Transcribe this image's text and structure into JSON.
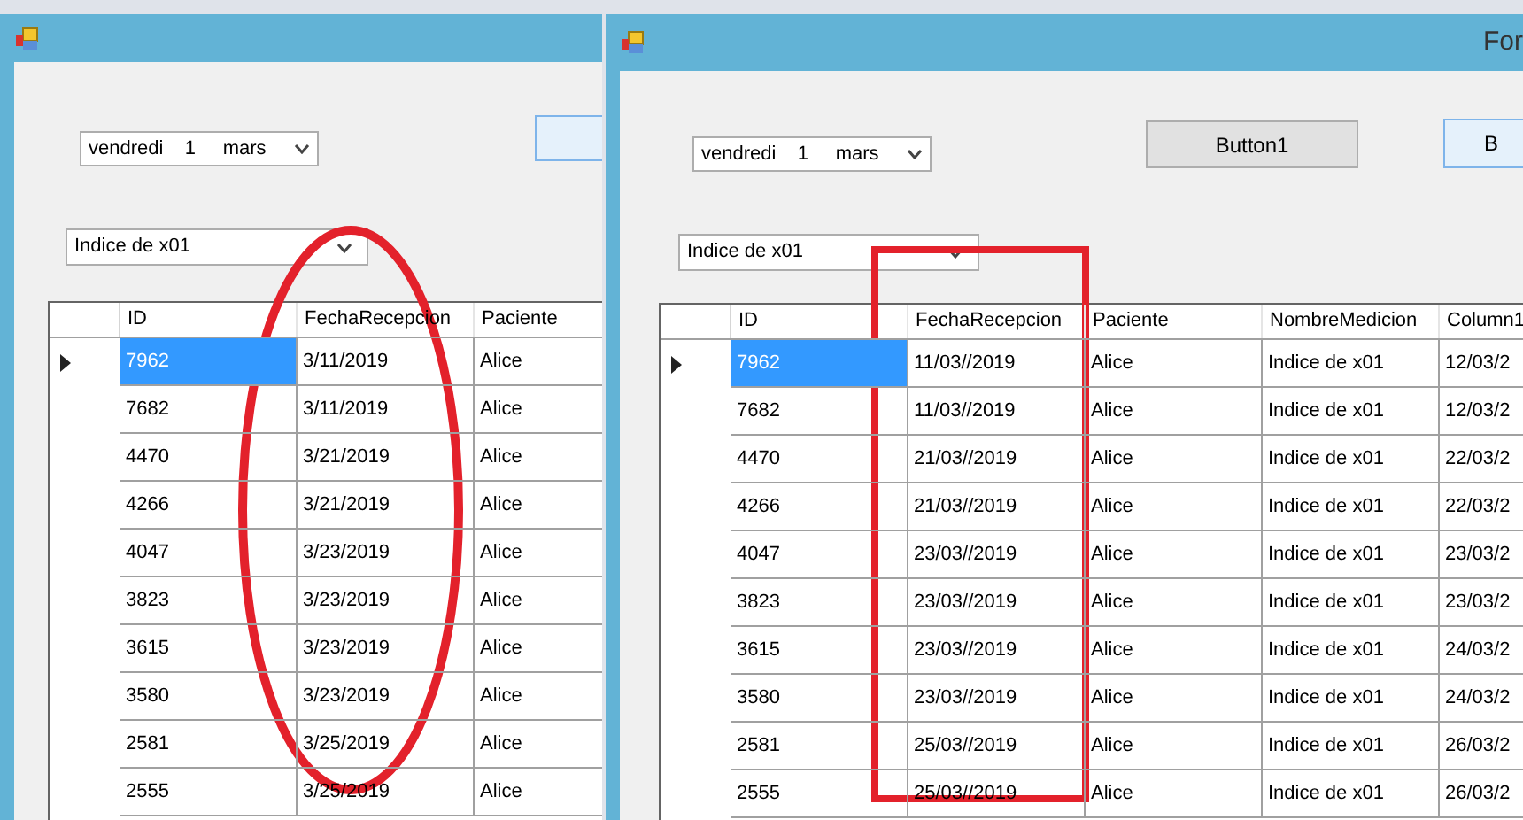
{
  "windows": [
    {
      "date_picker": {
        "value": "vendredi    1     mars"
      },
      "combo": {
        "value": "Indice de x01"
      },
      "grid": {
        "columns": [
          "ID",
          "FechaRecepcion",
          "Paciente"
        ],
        "rows": [
          {
            "selected": true,
            "cells": [
              "7962",
              "3/11/2019",
              "Alice"
            ]
          },
          {
            "selected": false,
            "cells": [
              "7682",
              "3/11/2019",
              "Alice"
            ]
          },
          {
            "selected": false,
            "cells": [
              "4470",
              "3/21/2019",
              "Alice"
            ]
          },
          {
            "selected": false,
            "cells": [
              "4266",
              "3/21/2019",
              "Alice"
            ]
          },
          {
            "selected": false,
            "cells": [
              "4047",
              "3/23/2019",
              "Alice"
            ]
          },
          {
            "selected": false,
            "cells": [
              "3823",
              "3/23/2019",
              "Alice"
            ]
          },
          {
            "selected": false,
            "cells": [
              "3615",
              "3/23/2019",
              "Alice"
            ]
          },
          {
            "selected": false,
            "cells": [
              "3580",
              "3/23/2019",
              "Alice"
            ]
          },
          {
            "selected": false,
            "cells": [
              "2581",
              "3/25/2019",
              "Alice"
            ]
          },
          {
            "selected": false,
            "cells": [
              "2555",
              "3/25/2019",
              "Alice"
            ]
          }
        ]
      },
      "annotation": {
        "kind": "ellipse"
      }
    },
    {
      "title": "For",
      "date_picker": {
        "value": "vendredi    1     mars"
      },
      "buttons": [
        "Button1",
        "B"
      ],
      "combo": {
        "value": "Indice de x01"
      },
      "grid": {
        "columns": [
          "ID",
          "FechaRecepcion",
          "Paciente",
          "NombreMedicion",
          "Column1"
        ],
        "rows": [
          {
            "selected": true,
            "cells": [
              "7962",
              "11/03//2019",
              "Alice",
              "Indice de x01",
              "12/03/2"
            ]
          },
          {
            "selected": false,
            "cells": [
              "7682",
              "11/03//2019",
              "Alice",
              "Indice de x01",
              "12/03/2"
            ]
          },
          {
            "selected": false,
            "cells": [
              "4470",
              "21/03//2019",
              "Alice",
              "Indice de x01",
              "22/03/2"
            ]
          },
          {
            "selected": false,
            "cells": [
              "4266",
              "21/03//2019",
              "Alice",
              "Indice de x01",
              "22/03/2"
            ]
          },
          {
            "selected": false,
            "cells": [
              "4047",
              "23/03//2019",
              "Alice",
              "Indice de x01",
              "23/03/2"
            ]
          },
          {
            "selected": false,
            "cells": [
              "3823",
              "23/03//2019",
              "Alice",
              "Indice de x01",
              "23/03/2"
            ]
          },
          {
            "selected": false,
            "cells": [
              "3615",
              "23/03//2019",
              "Alice",
              "Indice de x01",
              "24/03/2"
            ]
          },
          {
            "selected": false,
            "cells": [
              "3580",
              "23/03//2019",
              "Alice",
              "Indice de x01",
              "24/03/2"
            ]
          },
          {
            "selected": false,
            "cells": [
              "2581",
              "25/03//2019",
              "Alice",
              "Indice de x01",
              "26/03/2"
            ]
          },
          {
            "selected": false,
            "cells": [
              "2555",
              "25/03//2019",
              "Alice",
              "Indice de x01",
              "26/03/2"
            ]
          }
        ]
      },
      "annotation": {
        "kind": "rectangle"
      }
    }
  ]
}
